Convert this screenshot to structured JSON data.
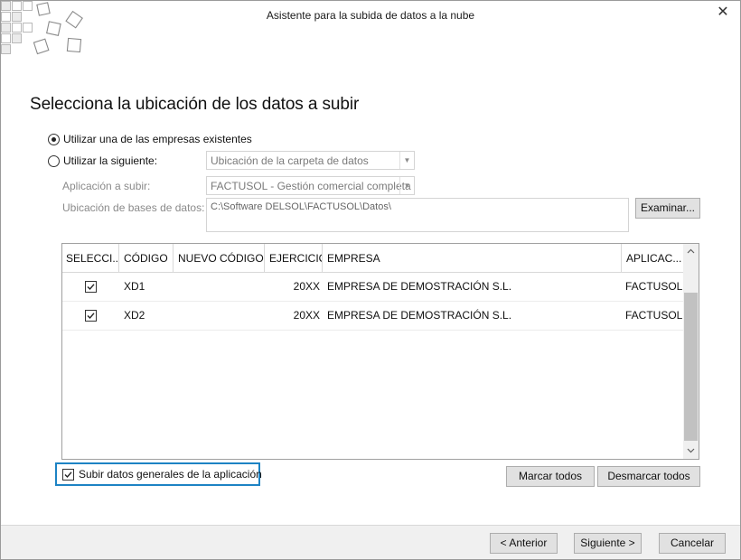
{
  "window": {
    "title": "Asistente para la subida de datos a la nube",
    "close_glyph": "✕"
  },
  "heading": "Selecciona la ubicación de los datos a subir",
  "options": {
    "existing_label": "Utilizar una de las empresas existentes",
    "existing_selected": true,
    "custom_label": "Utilizar la siguiente:",
    "custom_selected": false,
    "folder_combo_value": "Ubicación de la carpeta de datos",
    "app_label": "Aplicación a subir:",
    "app_combo_value": "FACTUSOL - Gestión comercial completa",
    "db_location_label": "Ubicación de bases de datos:",
    "db_location_value": "C:\\Software DELSOL\\FACTUSOL\\Datos\\",
    "browse_button": "Examinar..."
  },
  "grid": {
    "columns": [
      "SELECCI...",
      "CÓDIGO",
      "NUEVO CÓDIGO",
      "EJERCICIO",
      "EMPRESA",
      "APLICAC..."
    ],
    "rows": [
      {
        "selected": true,
        "codigo": "XD1",
        "nuevo_codigo": "",
        "ejercicio": "20XX",
        "empresa": "EMPRESA DE DEMOSTRACIÓN S.L.",
        "aplicacion": "FACTUSOL"
      },
      {
        "selected": true,
        "codigo": "XD2",
        "nuevo_codigo": "",
        "ejercicio": "20XX",
        "empresa": "EMPRESA DE DEMOSTRACIÓN S.L.",
        "aplicacion": "FACTUSOL"
      }
    ],
    "scroll_up": "⌃",
    "scroll_down": "⌄"
  },
  "general_data": {
    "label": "Subir datos generales de la aplicación",
    "checked": true
  },
  "actions": {
    "mark_all": "Marcar todos",
    "unmark_all": "Desmarcar todos"
  },
  "footer": {
    "back": "< Anterior",
    "next": "Siguiente >",
    "cancel": "Cancelar"
  },
  "colors": {
    "focus_border": "#1d83c4",
    "button_face": "#e1e1e1",
    "footer_bg": "#f0f0f0"
  },
  "icons": [
    "app-logo-icon",
    "close-icon",
    "check-icon",
    "chevron-down-icon",
    "scroll-up-icon",
    "scroll-down-icon"
  ]
}
